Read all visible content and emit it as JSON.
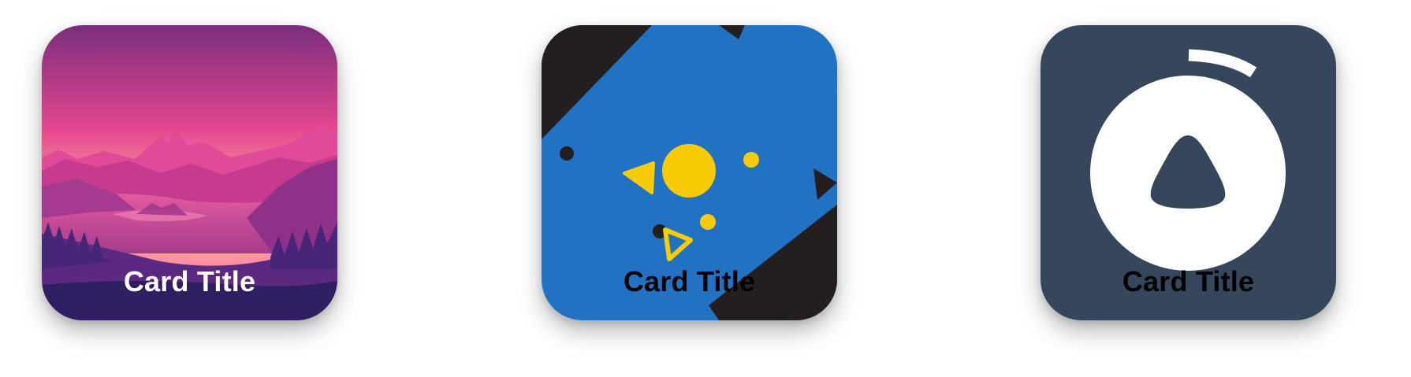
{
  "cards": [
    {
      "title": "Card Title",
      "title_color": "#ffffff",
      "background": "#7a2f78",
      "illustration": "sunset-mountain-lake"
    },
    {
      "title": "Card Title",
      "title_color": "#000000",
      "background": "#2272c3",
      "illustration": "geometric-shapes",
      "accent": "#f8cb07",
      "dark": "#231f20"
    },
    {
      "title": "Card Title",
      "title_color": "#000000",
      "background": "#35465d",
      "illustration": "stopwatch-icon",
      "foreground": "#ffffff"
    }
  ]
}
